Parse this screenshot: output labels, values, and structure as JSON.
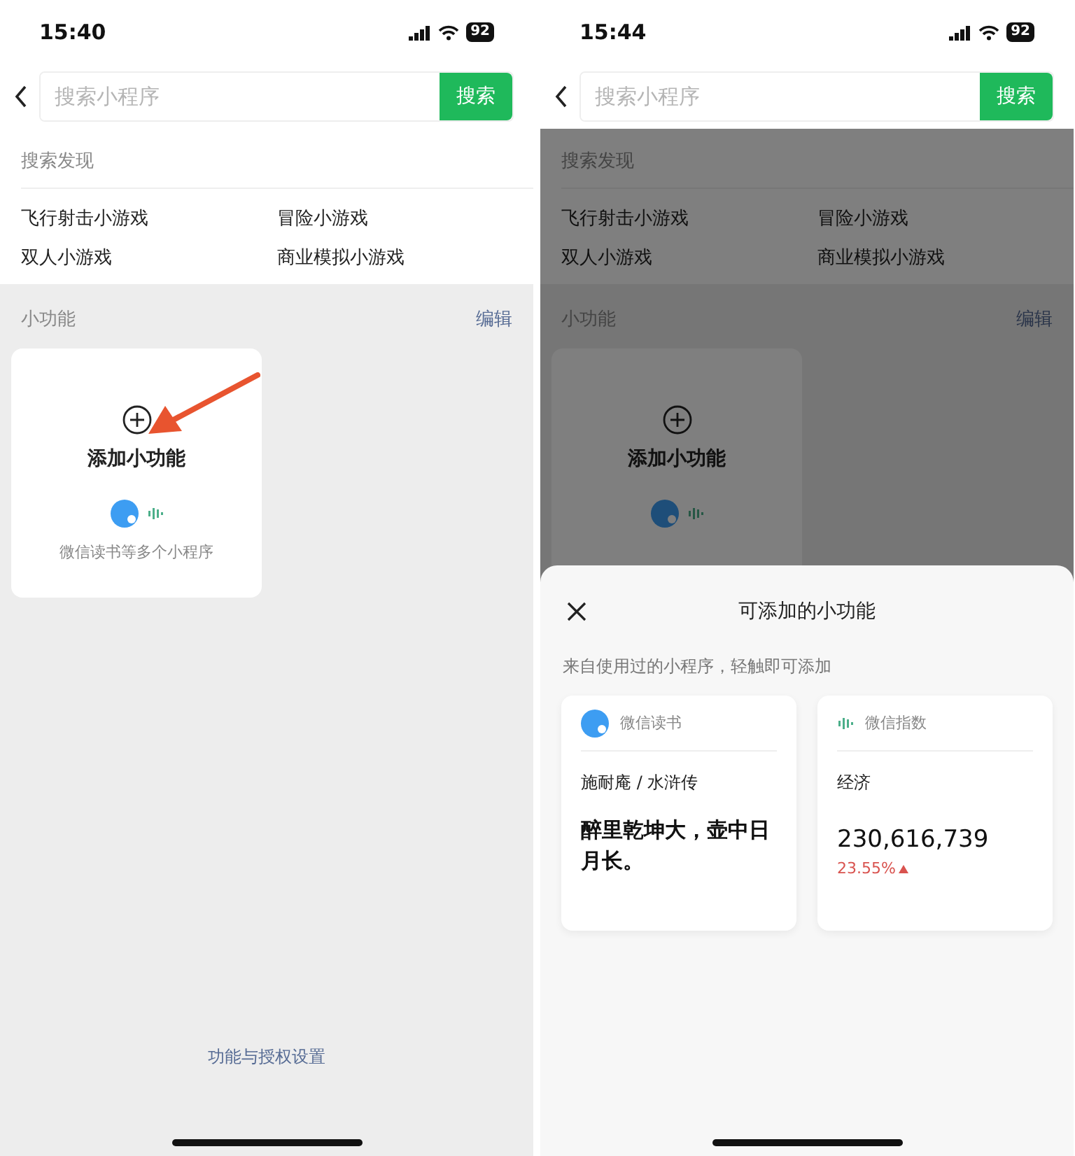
{
  "screens": [
    {
      "status_bar": {
        "time": "15:40",
        "battery": "92"
      },
      "search": {
        "placeholder": "搜索小程序",
        "button": "搜索"
      },
      "discover": {
        "title": "搜索发现",
        "items": [
          "飞行射击小游戏",
          "冒险小游戏",
          "双人小游戏",
          "商业模拟小游戏"
        ]
      },
      "widgets_section": {
        "title": "小功能",
        "edit": "编辑",
        "add_card": {
          "title": "添加小功能",
          "subtitle": "微信读书等多个小程序"
        }
      },
      "pointer_arrow": true,
      "dimmed": false,
      "footer_link": "功能与授权设置"
    },
    {
      "status_bar": {
        "time": "15:44",
        "battery": "92"
      },
      "search": {
        "placeholder": "搜索小程序",
        "button": "搜索"
      },
      "discover": {
        "title": "搜索发现",
        "items": [
          "飞行射击小游戏",
          "冒险小游戏",
          "双人小游戏",
          "商业模拟小游戏"
        ]
      },
      "widgets_section": {
        "title": "小功能",
        "edit": "编辑",
        "add_card": {
          "title": "添加小功能"
        }
      },
      "pointer_arrow": false,
      "dimmed": true,
      "sheet": {
        "title": "可添加的小功能",
        "subtitle": "来自使用过的小程序，轻触即可添加",
        "widgets": [
          {
            "kind": "quote",
            "app": "微信读书",
            "source": "施耐庵 / 水浒传",
            "text": "醉里乾坤大，壶中日月长。"
          },
          {
            "kind": "index",
            "app": "微信指数",
            "topic": "经济",
            "value": "230,616,739",
            "change": "23.55%"
          }
        ]
      }
    }
  ]
}
